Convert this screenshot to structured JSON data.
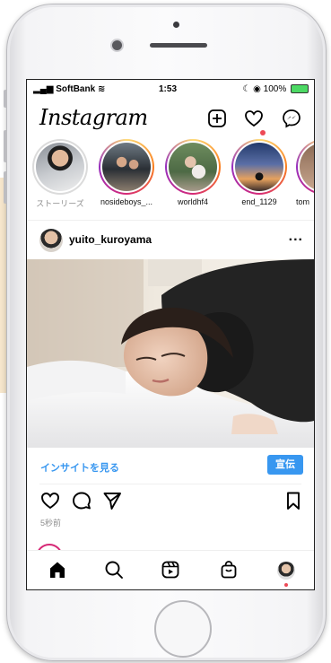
{
  "status_bar": {
    "carrier": "SoftBank",
    "time": "1:53",
    "battery": "100%"
  },
  "app": {
    "logo": "Instagram"
  },
  "top_icons": [
    "plus-square-icon",
    "heart-icon",
    "messenger-icon"
  ],
  "stories": [
    {
      "label": "ストーリーズ",
      "own": true
    },
    {
      "label": "nosideboys_..."
    },
    {
      "label": "worldhf4"
    },
    {
      "label": "end_1129"
    },
    {
      "label": "tom"
    }
  ],
  "post": {
    "username": "yuito_kuroyama",
    "more_label": "...",
    "insight_link": "インサイトを見る",
    "promote_button": "宣伝",
    "timestamp": "5秒前"
  },
  "tab_bar": [
    "home-icon",
    "search-icon",
    "reels-icon",
    "shop-icon",
    "profile-avatar"
  ],
  "colors": {
    "accent_blue": "#3897f0",
    "notification_red": "#ed4956",
    "battery_green": "#4cd964"
  }
}
